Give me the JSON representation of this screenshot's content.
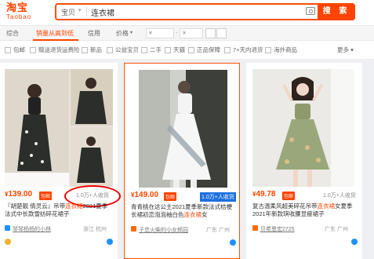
{
  "header": {
    "logo_cn": "淘宝",
    "logo_en": "Taobao",
    "search_scope": "宝贝",
    "search_query": "连衣裙",
    "search_button": "搜 索"
  },
  "sortbar": {
    "items": [
      "综合",
      "销量从高到低",
      "信用",
      "价格"
    ],
    "active": "销量从高到低",
    "price_from": "¥",
    "price_to": "¥",
    "dash": "-"
  },
  "filters": {
    "items": [
      "包邮",
      "赠送退货运费险",
      "新品",
      "公益宝贝",
      "二手",
      "天猫",
      "正品保障",
      "7+天内退货",
      "海外商品"
    ],
    "more": "更多"
  },
  "products": [
    {
      "price": "139.00",
      "yen": "¥",
      "bao": "包邮",
      "sold": "1.0万+人收货",
      "title_pre": "『胡楚靓 倩灵云』吊带",
      "title_hl": "连衣裙",
      "title_post": "2021夏季法式中长款雪纺碎花裙子",
      "store": "琴琴杨杨的小林",
      "location": "浙江 杭州"
    },
    {
      "price": "149.00",
      "yen": "¥",
      "bao": "包邮",
      "sold": "1.0万+人收货",
      "title_pre": "青青桃在这公主2021夏季新款法式桔梗长裙初恋泡泡袖白色",
      "title_hl": "连衣裙",
      "title_post": "女",
      "store": "子恋火柴的小女郎园",
      "location": "广东 广州"
    },
    {
      "price": "49.78",
      "yen": "¥",
      "bao": "包邮",
      "sold": "1.0万+人收货",
      "title_pre": "复古温柔风超美碎花吊带",
      "title_hl": "连衣裙",
      "title_post": "女夏季2021年新款琪收腰显瘦裙子",
      "store": "贝希恩宏2725",
      "location": "广东 广州"
    }
  ],
  "colors": {
    "brand": "#ff4400",
    "annotation_circle": "#e00000",
    "highlight_blue": "#1a6fe0"
  }
}
